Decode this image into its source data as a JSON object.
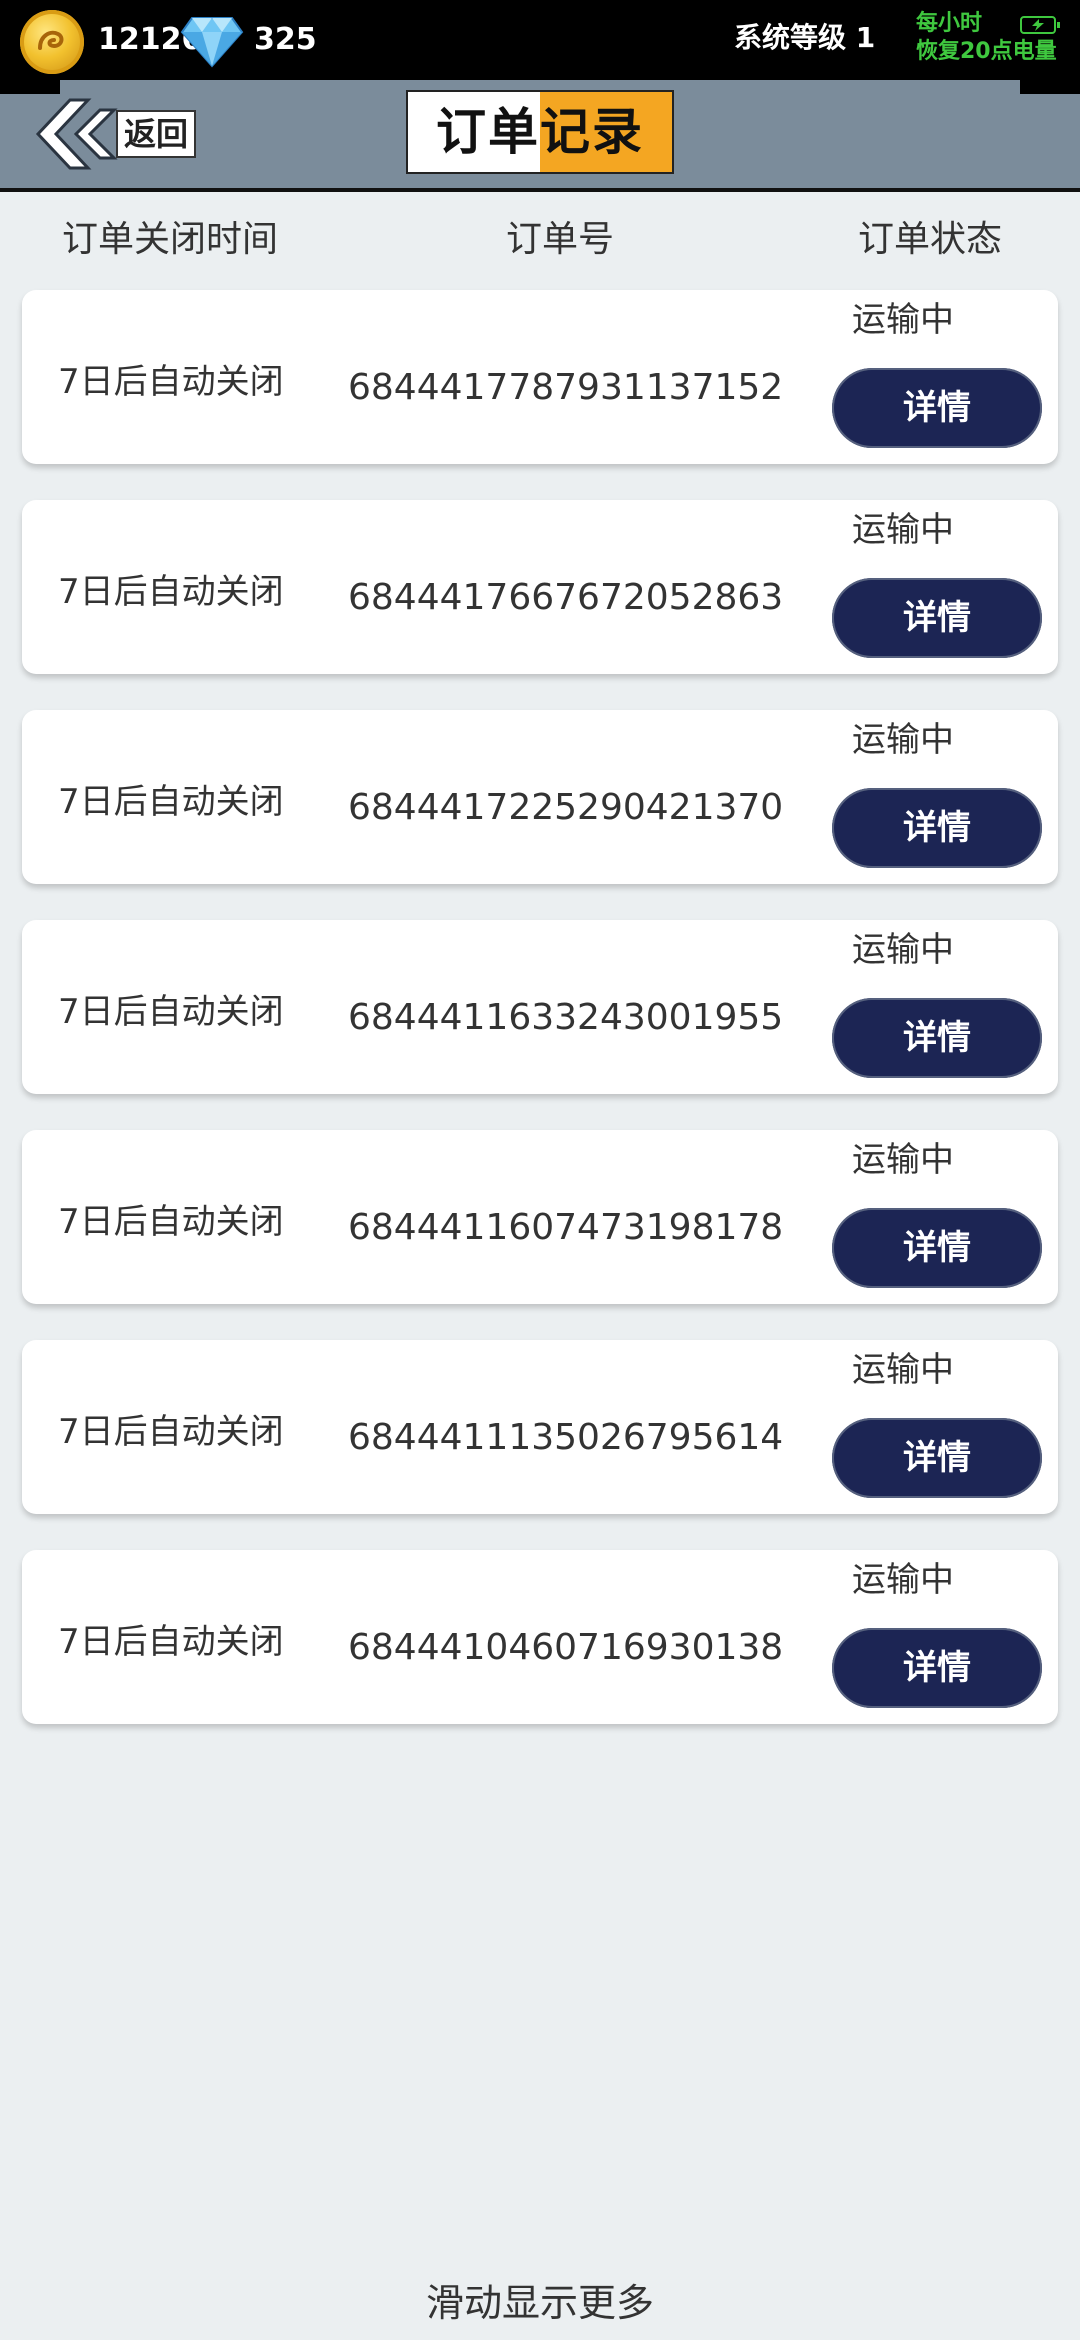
{
  "topbar": {
    "coin_icon": "gold-coin-icon",
    "coins": "12126",
    "gem_icon": "diamond-icon",
    "gems": "325",
    "system_level": "系统等级 1",
    "recover_line1": "每小时",
    "recover_line2": "恢复20点电量",
    "battery_icon": "battery-charging-icon"
  },
  "header": {
    "back_icon": "chevron-double-left-icon",
    "back_label": "返回",
    "title": "订单记录"
  },
  "columns": {
    "close_time": "订单关闭时间",
    "order_id": "订单号",
    "status": "订单状态"
  },
  "orders": [
    {
      "close": "7日后自动关闭",
      "id": "6844417787931137152",
      "status": "运输中",
      "action": "详情"
    },
    {
      "close": "7日后自动关闭",
      "id": "6844417667672052863",
      "status": "运输中",
      "action": "详情"
    },
    {
      "close": "7日后自动关闭",
      "id": "6844417225290421370",
      "status": "运输中",
      "action": "详情"
    },
    {
      "close": "7日后自动关闭",
      "id": "6844411633243001955",
      "status": "运输中",
      "action": "详情"
    },
    {
      "close": "7日后自动关闭",
      "id": "6844411607473198178",
      "status": "运输中",
      "action": "详情"
    },
    {
      "close": "7日后自动关闭",
      "id": "6844411135026795614",
      "status": "运输中",
      "action": "详情"
    },
    {
      "close": "7日后自动关闭",
      "id": "6844410460716930138",
      "status": "运输中",
      "action": "详情"
    }
  ],
  "footer": {
    "scroll_hint": "滑动显示更多"
  },
  "colors": {
    "topbar_bg": "#000000",
    "header_bg": "#7b8c9b",
    "title_accent": "#f4a622",
    "page_bg": "#ebeff1",
    "detail_button_bg": "#1c2554",
    "recover_text": "#3fc83f"
  }
}
